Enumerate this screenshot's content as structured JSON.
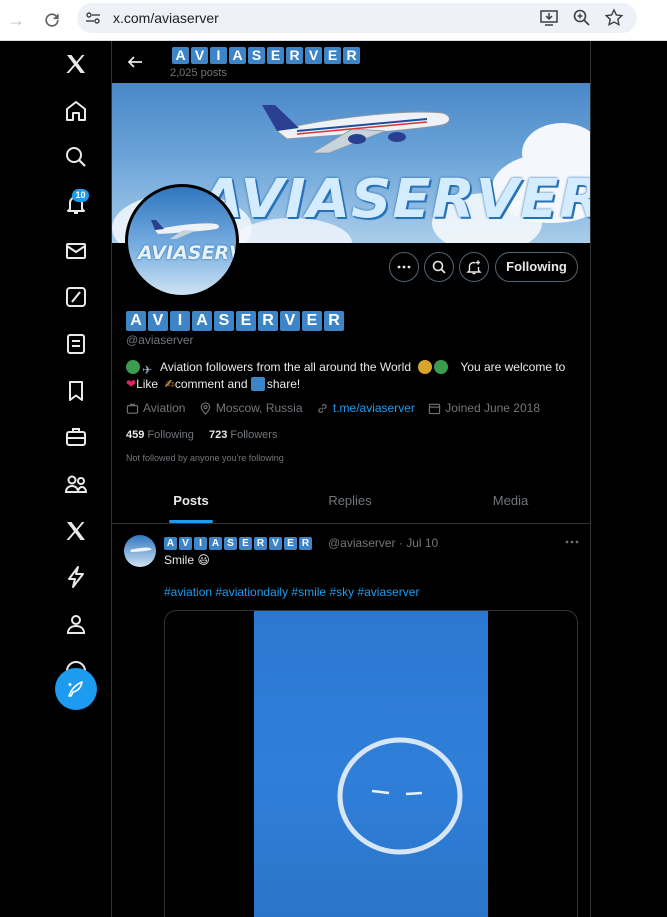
{
  "browser": {
    "url": "x.com/aviaserver"
  },
  "header": {
    "name_letters": [
      "A",
      "V",
      "I",
      "A",
      "S",
      "E",
      "R",
      "V",
      "E",
      "R"
    ],
    "posts_count": "2,025 posts"
  },
  "banner": {
    "title": "AVIASERVER"
  },
  "avatar": {
    "text": "AVIASERVER"
  },
  "nav": {
    "notifications_badge": "10"
  },
  "actions": {
    "following_label": "Following"
  },
  "profile": {
    "name_letters": [
      "A",
      "V",
      "I",
      "A",
      "S",
      "E",
      "R",
      "V",
      "E",
      "R"
    ],
    "handle": "@aviaserver",
    "bio_line1_a": "Aviation followers from the all around the World",
    "bio_line1_b": "You are welcome to",
    "bio_like": "Like",
    "bio_comment": "comment and",
    "bio_share": "share!",
    "category": "Aviation",
    "location": "Moscow, Russia",
    "link": "t.me/aviaserver",
    "joined": "Joined June 2018",
    "following_count": "459",
    "following_label": "Following",
    "followers_count": "723",
    "followers_label": "Followers",
    "not_followed": "Not followed by anyone you're following"
  },
  "tabs": {
    "posts": "Posts",
    "replies": "Replies",
    "media": "Media"
  },
  "post": {
    "author_letters": [
      "A",
      "V",
      "I",
      "A",
      "S",
      "E",
      "R",
      "V",
      "E",
      "R"
    ],
    "meta": "@aviaserver · Jul 10",
    "text": "Smile 😃",
    "hashtags": "#aviation #aviationdaily #smile #sky #aviaserver"
  },
  "icons": {
    "back": "arrow-left-icon",
    "x_logo": "x-logo-icon",
    "home": "home-icon",
    "search": "search-icon",
    "notifications": "bell-icon",
    "messages": "mail-icon",
    "grok": "grok-icon",
    "lists": "list-icon",
    "bookmarks": "bookmark-icon",
    "jobs": "briefcase-icon",
    "communities": "people-icon",
    "premium": "x-logo-icon",
    "verified_orgs": "lightning-icon",
    "profile": "person-icon",
    "more": "more-circle-icon",
    "post": "feather-icon"
  },
  "colors": {
    "accent": "#1d9bf0",
    "background": "#000000",
    "name_tile": "#3d85c6"
  }
}
